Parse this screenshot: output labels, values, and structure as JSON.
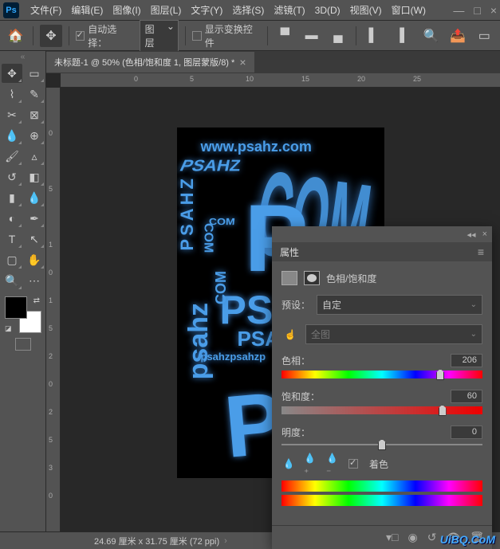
{
  "menubar": {
    "items": [
      "文件(F)",
      "编辑(E)",
      "图像(I)",
      "图层(L)",
      "文字(Y)",
      "选择(S)",
      "滤镜(T)",
      "3D(D)",
      "视图(V)",
      "窗口(W)"
    ]
  },
  "optionsbar": {
    "auto_select_label": "自动选择：",
    "auto_select_value": "图层",
    "show_transform_label": "显示变换控件"
  },
  "document": {
    "tab_title": "未标题-1 @ 50% (色相/饱和度 1, 图层蒙版/8) *",
    "status": "24.69 厘米 x 31.75 厘米 (72 ppi)"
  },
  "ruler_h": [
    "0",
    "5",
    "10",
    "15",
    "20",
    "25"
  ],
  "ruler_v": [
    "0",
    "5",
    "1",
    "0",
    "1",
    "5",
    "2",
    "0",
    "2",
    "5",
    "3",
    "0"
  ],
  "artwork": {
    "url": "www.psahz.com",
    "big_p": "P",
    "psa": "PSA",
    "psahz": "PSAHZ",
    "psahz2": "psahz",
    "com": "COM",
    "repeat": "psahzpsahzp"
  },
  "panel": {
    "title": "属性",
    "adj_name": "色相/饱和度",
    "preset_label": "预设：",
    "preset_value": "自定",
    "channel_value": "全图",
    "hue_label": "色相：",
    "hue_value": "206",
    "sat_label": "饱和度：",
    "sat_value": "60",
    "light_label": "明度：",
    "light_value": "0",
    "colorize_label": "着色"
  },
  "watermark": "UiBQ.CoM"
}
